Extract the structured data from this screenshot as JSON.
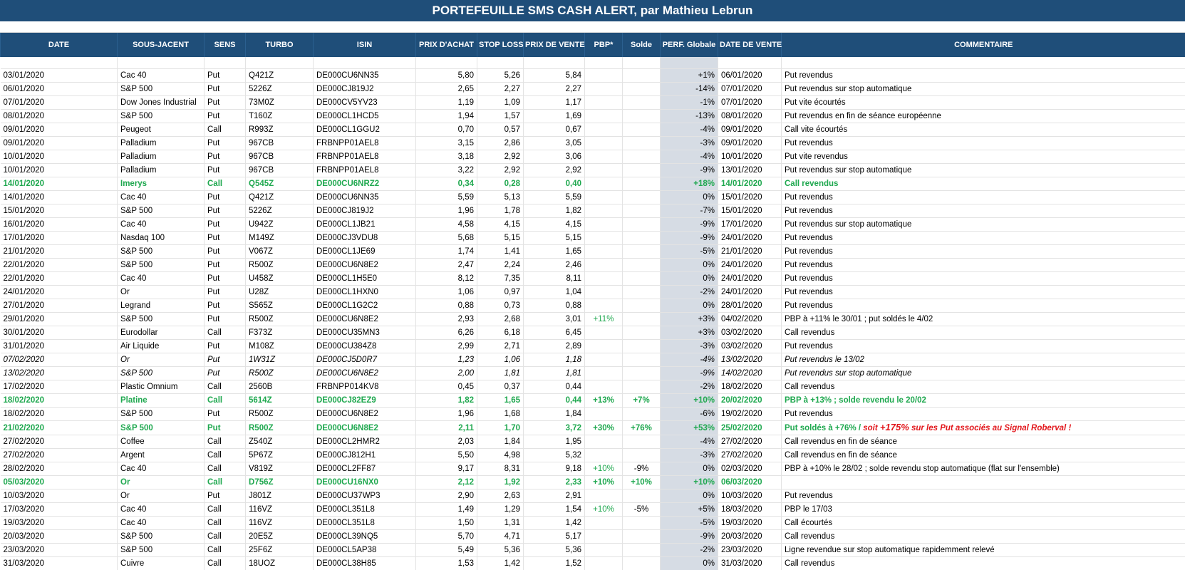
{
  "title": "PORTEFEUILLE SMS CASH ALERT, par Mathieu Lebrun",
  "headers": {
    "date": "DATE",
    "sous_jacent": "SOUS-JACENT",
    "sens": "SENS",
    "turbo": "TURBO",
    "isin": "ISIN",
    "prix_achat": "PRIX D'ACHAT",
    "stop_loss": "STOP LOSS",
    "prix_vente": "PRIX DE VENTE",
    "pbp": "PBP*",
    "solde": "Solde",
    "perf": "PERF. Globale",
    "date_vente": "DATE DE VENTE",
    "commentaire": "COMMENTAIRE"
  },
  "colors": {
    "header_bg": "#1f4e79",
    "win_text": "#1fa84f",
    "perf_col_bg": "#d6dce4",
    "highlight_red": "#e2161b"
  },
  "rows": [
    {
      "date": "03/01/2020",
      "sj": "Cac 40",
      "sens": "Put",
      "turbo": "Q421Z",
      "isin": "DE000CU6NN35",
      "pa": "5,80",
      "sl": "5,26",
      "pv": "5,84",
      "pbp": "",
      "solde": "",
      "perf": "+1%",
      "dv": "06/01/2020",
      "comment": "Put revendus",
      "style": ""
    },
    {
      "date": "06/01/2020",
      "sj": "S&P 500",
      "sens": "Put",
      "turbo": "5226Z",
      "isin": "DE000CJ819J2",
      "pa": "2,65",
      "sl": "2,27",
      "pv": "2,27",
      "pbp": "",
      "solde": "",
      "perf": "-14%",
      "dv": "07/01/2020",
      "comment": "Put revendus sur stop automatique",
      "style": ""
    },
    {
      "date": "07/01/2020",
      "sj": "Dow Jones Industrial",
      "sens": "Put",
      "turbo": "73M0Z",
      "isin": "DE000CV5YV23",
      "pa": "1,19",
      "sl": "1,09",
      "pv": "1,17",
      "pbp": "",
      "solde": "",
      "perf": "-1%",
      "dv": "07/01/2020",
      "comment": "Put vite écourtés",
      "style": ""
    },
    {
      "date": "08/01/2020",
      "sj": "S&P 500",
      "sens": "Put",
      "turbo": "T160Z",
      "isin": "DE000CL1HCD5",
      "pa": "1,94",
      "sl": "1,57",
      "pv": "1,69",
      "pbp": "",
      "solde": "",
      "perf": "-13%",
      "dv": "08/01/2020",
      "comment": "Put revendus en fin de séance européenne",
      "style": ""
    },
    {
      "date": "09/01/2020",
      "sj": "Peugeot",
      "sens": "Call",
      "turbo": "R993Z",
      "isin": "DE000CL1GGU2",
      "pa": "0,70",
      "sl": "0,57",
      "pv": "0,67",
      "pbp": "",
      "solde": "",
      "perf": "-4%",
      "dv": "09/01/2020",
      "comment": "Call vite écourtés",
      "style": ""
    },
    {
      "date": "09/01/2020",
      "sj": "Palladium",
      "sens": "Put",
      "turbo": "967CB",
      "isin": "FRBNPP01AEL8",
      "pa": "3,15",
      "sl": "2,86",
      "pv": "3,05",
      "pbp": "",
      "solde": "",
      "perf": "-3%",
      "dv": "09/01/2020",
      "comment": "Put revendus",
      "style": ""
    },
    {
      "date": "10/01/2020",
      "sj": "Palladium",
      "sens": "Put",
      "turbo": "967CB",
      "isin": "FRBNPP01AEL8",
      "pa": "3,18",
      "sl": "2,92",
      "pv": "3,06",
      "pbp": "",
      "solde": "",
      "perf": "-4%",
      "dv": "10/01/2020",
      "comment": "Put vite revendus",
      "style": ""
    },
    {
      "date": "10/01/2020",
      "sj": "Palladium",
      "sens": "Put",
      "turbo": "967CB",
      "isin": "FRBNPP01AEL8",
      "pa": "3,22",
      "sl": "2,92",
      "pv": "2,92",
      "pbp": "",
      "solde": "",
      "perf": "-9%",
      "dv": "13/01/2020",
      "comment": "Put revendus sur stop automatique",
      "style": ""
    },
    {
      "date": "14/01/2020",
      "sj": "Imerys",
      "sens": "Call",
      "turbo": "Q545Z",
      "isin": "DE000CU6NRZ2",
      "pa": "0,34",
      "sl": "0,28",
      "pv": "0,40",
      "pbp": "",
      "solde": "",
      "perf": "+18%",
      "dv": "14/01/2020",
      "comment": "Call revendus",
      "style": "win"
    },
    {
      "date": "14/01/2020",
      "sj": "Cac 40",
      "sens": "Put",
      "turbo": "Q421Z",
      "isin": "DE000CU6NN35",
      "pa": "5,59",
      "sl": "5,13",
      "pv": "5,59",
      "pbp": "",
      "solde": "",
      "perf": "0%",
      "dv": "15/01/2020",
      "comment": "Put revendus",
      "style": ""
    },
    {
      "date": "15/01/2020",
      "sj": "S&P 500",
      "sens": "Put",
      "turbo": "5226Z",
      "isin": "DE000CJ819J2",
      "pa": "1,96",
      "sl": "1,78",
      "pv": "1,82",
      "pbp": "",
      "solde": "",
      "perf": "-7%",
      "dv": "15/01/2020",
      "comment": "Put revendus",
      "style": ""
    },
    {
      "date": "16/01/2020",
      "sj": "Cac 40",
      "sens": "Put",
      "turbo": "U942Z",
      "isin": "DE000CL1JB21",
      "pa": "4,58",
      "sl": "4,15",
      "pv": "4,15",
      "pbp": "",
      "solde": "",
      "perf": "-9%",
      "dv": "17/01/2020",
      "comment": "Put revendus sur stop automatique",
      "style": ""
    },
    {
      "date": "17/01/2020",
      "sj": "Nasdaq 100",
      "sens": "Put",
      "turbo": "M149Z",
      "isin": "DE000CJ3VDU8",
      "pa": "5,68",
      "sl": "5,15",
      "pv": "5,15",
      "pbp": "",
      "solde": "",
      "perf": "-9%",
      "dv": "24/01/2020",
      "comment": "Put revendus",
      "style": ""
    },
    {
      "date": "21/01/2020",
      "sj": "S&P 500",
      "sens": "Put",
      "turbo": "V067Z",
      "isin": "DE000CL1JE69",
      "pa": "1,74",
      "sl": "1,41",
      "pv": "1,65",
      "pbp": "",
      "solde": "",
      "perf": "-5%",
      "dv": "21/01/2020",
      "comment": "Put revendus",
      "style": ""
    },
    {
      "date": "22/01/2020",
      "sj": "S&P 500",
      "sens": "Put",
      "turbo": "R500Z",
      "isin": "DE000CU6N8E2",
      "pa": "2,47",
      "sl": "2,24",
      "pv": "2,46",
      "pbp": "",
      "solde": "",
      "perf": "0%",
      "dv": "24/01/2020",
      "comment": "Put revendus",
      "style": ""
    },
    {
      "date": "22/01/2020",
      "sj": "Cac 40",
      "sens": "Put",
      "turbo": "U458Z",
      "isin": "DE000CL1H5E0",
      "pa": "8,12",
      "sl": "7,35",
      "pv": "8,11",
      "pbp": "",
      "solde": "",
      "perf": "0%",
      "dv": "24/01/2020",
      "comment": "Put revendus",
      "style": ""
    },
    {
      "date": "24/01/2020",
      "sj": "Or",
      "sens": "Put",
      "turbo": "U28Z",
      "isin": "DE000CL1HXN0",
      "pa": "1,06",
      "sl": "0,97",
      "pv": "1,04",
      "pbp": "",
      "solde": "",
      "perf": "-2%",
      "dv": "24/01/2020",
      "comment": "Put revendus",
      "style": ""
    },
    {
      "date": "27/01/2020",
      "sj": "Legrand",
      "sens": "Put",
      "turbo": "S565Z",
      "isin": "DE000CL1G2C2",
      "pa": "0,88",
      "sl": "0,73",
      "pv": "0,88",
      "pbp": "",
      "solde": "",
      "perf": "0%",
      "dv": "28/01/2020",
      "comment": "Put revendus",
      "style": ""
    },
    {
      "date": "29/01/2020",
      "sj": "S&P 500",
      "sens": "Put",
      "turbo": "R500Z",
      "isin": "DE000CU6N8E2",
      "pa": "2,93",
      "sl": "2,68",
      "pv": "3,01",
      "pbp": "+11%",
      "solde": "",
      "perf": "+3%",
      "dv": "04/02/2020",
      "comment": "PBP à +11% le 30/01 ; put soldés le 4/02",
      "style": "pbpgreen"
    },
    {
      "date": "30/01/2020",
      "sj": "Eurodollar",
      "sens": "Call",
      "turbo": "F373Z",
      "isin": "DE000CU35MN3",
      "pa": "6,26",
      "sl": "6,18",
      "pv": "6,45",
      "pbp": "",
      "solde": "",
      "perf": "+3%",
      "dv": "03/02/2020",
      "comment": "Call revendus",
      "style": ""
    },
    {
      "date": "31/01/2020",
      "sj": "Air Liquide",
      "sens": "Put",
      "turbo": "M108Z",
      "isin": "DE000CU384Z8",
      "pa": "2,99",
      "sl": "2,71",
      "pv": "2,89",
      "pbp": "",
      "solde": "",
      "perf": "-3%",
      "dv": "03/02/2020",
      "comment": "Put revendus",
      "style": ""
    },
    {
      "date": "07/02/2020",
      "sj": "Or",
      "sens": "Put",
      "turbo": "1W31Z",
      "isin": "DE000CJ5D0R7",
      "pa": "1,23",
      "sl": "1,06",
      "pv": "1,18",
      "pbp": "",
      "solde": "",
      "perf": "-4%",
      "dv": "13/02/2020",
      "comment": "Put revendus le 13/02",
      "style": "ital"
    },
    {
      "date": "13/02/2020",
      "sj": "S&P 500",
      "sens": "Put",
      "turbo": "R500Z",
      "isin": "DE000CU6N8E2",
      "pa": "2,00",
      "sl": "1,81",
      "pv": "1,81",
      "pbp": "",
      "solde": "",
      "perf": "-9%",
      "dv": "14/02/2020",
      "comment": "Put revendus sur stop automatique",
      "style": "ital"
    },
    {
      "date": "17/02/2020",
      "sj": "Plastic Omnium",
      "sens": "Call",
      "turbo": "2560B",
      "isin": "FRBNPP014KV8",
      "pa": "0,45",
      "sl": "0,37",
      "pv": "0,44",
      "pbp": "",
      "solde": "",
      "perf": "-2%",
      "dv": "18/02/2020",
      "comment": "Call revendus",
      "style": ""
    },
    {
      "date": "18/02/2020",
      "sj": "Platine",
      "sens": "Call",
      "turbo": "5614Z",
      "isin": "DE000CJ82EZ9",
      "pa": "1,82",
      "sl": "1,65",
      "pv": "0,44",
      "pbp": "+13%",
      "solde": "+7%",
      "perf": "+10%",
      "dv": "20/02/2020",
      "comment": "PBP à +13% ; solde revendu le 20/02",
      "style": "win"
    },
    {
      "date": "18/02/2020",
      "sj": "S&P 500",
      "sens": "Put",
      "turbo": "R500Z",
      "isin": "DE000CU6N8E2",
      "pa": "1,96",
      "sl": "1,68",
      "pv": "1,84",
      "pbp": "",
      "solde": "",
      "perf": "-6%",
      "dv": "19/02/2020",
      "comment": "Put revendus",
      "style": ""
    },
    {
      "date": "21/02/2020",
      "sj": "S&P 500",
      "sens": "Put",
      "turbo": "R500Z",
      "isin": "DE000CU6N8E2",
      "pa": "2,11",
      "sl": "1,70",
      "pv": "3,72",
      "pbp": "+30%",
      "solde": "+76%",
      "perf": "+53%",
      "dv": "25/02/2020",
      "comment": "Put soldés à +76% / ",
      "note_a": "soit ",
      "note_b": "+175%",
      "note_c": " sur les Put associés au Signal Roberval !",
      "style": "win"
    },
    {
      "date": "27/02/2020",
      "sj": "Coffee",
      "sens": "Call",
      "turbo": "Z540Z",
      "isin": "DE000CL2HMR2",
      "pa": "2,03",
      "sl": "1,84",
      "pv": "1,95",
      "pbp": "",
      "solde": "",
      "perf": "-4%",
      "dv": "27/02/2020",
      "comment": "Call revendus en fin de séance",
      "style": ""
    },
    {
      "date": "27/02/2020",
      "sj": "Argent",
      "sens": "Call",
      "turbo": "5P67Z",
      "isin": "DE000CJ812H1",
      "pa": "5,50",
      "sl": "4,98",
      "pv": "5,32",
      "pbp": "",
      "solde": "",
      "perf": "-3%",
      "dv": "27/02/2020",
      "comment": "Call revendus  en fin de séance",
      "style": ""
    },
    {
      "date": "28/02/2020",
      "sj": "Cac 40",
      "sens": "Call",
      "turbo": "V819Z",
      "isin": "DE000CL2FF87",
      "pa": "9,17",
      "sl": "8,31",
      "pv": "9,18",
      "pbp": "+10%",
      "solde": "-9%",
      "perf": "0%",
      "dv": "02/03/2020",
      "comment": "PBP à +10% le 28/02 ; solde revendu stop automatique (flat sur l'ensemble)",
      "style": "pbpgreen"
    },
    {
      "date": "05/03/2020",
      "sj": "Or",
      "sens": "Call",
      "turbo": "D756Z",
      "isin": "DE000CU16NX0",
      "pa": "2,12",
      "sl": "1,92",
      "pv": "2,33",
      "pbp": "+10%",
      "solde": "+10%",
      "perf": "+10%",
      "dv": "06/03/2020",
      "comment": "",
      "style": "win"
    },
    {
      "date": "10/03/2020",
      "sj": "Or",
      "sens": "Put",
      "turbo": "J801Z",
      "isin": "DE000CU37WP3",
      "pa": "2,90",
      "sl": "2,63",
      "pv": "2,91",
      "pbp": "",
      "solde": "",
      "perf": "0%",
      "dv": "10/03/2020",
      "comment": "Put revendus",
      "style": ""
    },
    {
      "date": "17/03/2020",
      "sj": "Cac 40",
      "sens": "Call",
      "turbo": "116VZ",
      "isin": "DE000CL351L8",
      "pa": "1,49",
      "sl": "1,29",
      "pv": "1,54",
      "pbp": "+10%",
      "solde": "-5%",
      "perf": "+5%",
      "dv": "18/03/2020",
      "comment": "PBP le 17/03",
      "style": "pbpgreen"
    },
    {
      "date": "19/03/2020",
      "sj": "Cac 40",
      "sens": "Call",
      "turbo": "116VZ",
      "isin": "DE000CL351L8",
      "pa": "1,50",
      "sl": "1,31",
      "pv": "1,42",
      "pbp": "",
      "solde": "",
      "perf": "-5%",
      "dv": "19/03/2020",
      "comment": "Call écourtés",
      "style": ""
    },
    {
      "date": "20/03/2020",
      "sj": "S&P 500",
      "sens": "Call",
      "turbo": "20E5Z",
      "isin": "DE000CL39NQ5",
      "pa": "5,70",
      "sl": "4,71",
      "pv": "5,17",
      "pbp": "",
      "solde": "",
      "perf": "-9%",
      "dv": "20/03/2020",
      "comment": "Call revendus",
      "style": ""
    },
    {
      "date": "23/03/2020",
      "sj": "S&P 500",
      "sens": "Call",
      "turbo": "25F6Z",
      "isin": "DE000CL5AP38",
      "pa": "5,49",
      "sl": "5,36",
      "pv": "5,36",
      "pbp": "",
      "solde": "",
      "perf": "-2%",
      "dv": "23/03/2020",
      "comment": "Ligne revendue sur stop automatique rapidemment relevé",
      "style": ""
    },
    {
      "date": "31/03/2020",
      "sj": "Cuivre",
      "sens": "Call",
      "turbo": "18UOZ",
      "isin": "DE000CL38H85",
      "pa": "1,53",
      "sl": "1,42",
      "pv": "1,52",
      "pbp": "",
      "solde": "",
      "perf": "0%",
      "dv": "31/03/2020",
      "comment": "Call revendus",
      "style": ""
    }
  ]
}
